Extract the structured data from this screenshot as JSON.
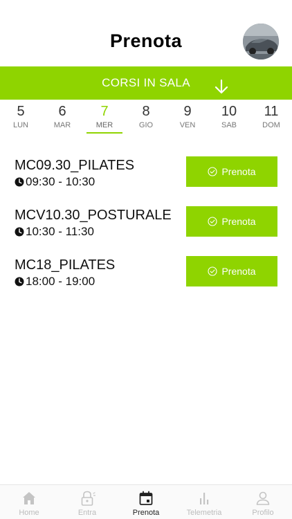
{
  "header": {
    "title": "Prenota"
  },
  "category": {
    "label": "CORSI IN SALA"
  },
  "days": [
    {
      "num": "5",
      "dow": "LUN"
    },
    {
      "num": "6",
      "dow": "MAR"
    },
    {
      "num": "7",
      "dow": "MER"
    },
    {
      "num": "8",
      "dow": "GIO"
    },
    {
      "num": "9",
      "dow": "VEN"
    },
    {
      "num": "10",
      "dow": "SAB"
    },
    {
      "num": "11",
      "dow": "DOM"
    }
  ],
  "selected_day_index": 2,
  "courses": [
    {
      "name": "MC09.30_PILATES",
      "time": "09:30 - 10:30",
      "button": "Prenota"
    },
    {
      "name": "MCV10.30_POSTURALE",
      "time": "10:30 - 11:30",
      "button": "Prenota"
    },
    {
      "name": "MC18_PILATES",
      "time": "18:00 - 19:00",
      "button": "Prenota"
    }
  ],
  "tabs": [
    {
      "label": "Home",
      "icon": "home-icon"
    },
    {
      "label": "Entra",
      "icon": "lock-icon"
    },
    {
      "label": "Prenota",
      "icon": "calendar-icon"
    },
    {
      "label": "Telemetria",
      "icon": "bar-chart-icon"
    },
    {
      "label": "Profilo",
      "icon": "user-icon"
    }
  ],
  "active_tab_index": 2,
  "colors": {
    "accent": "#8fd400",
    "text": "#111111",
    "tab_inactive": "#bbbbbb"
  }
}
